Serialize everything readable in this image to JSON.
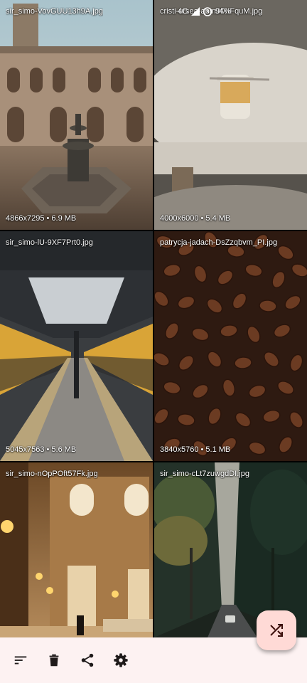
{
  "status_bar": {
    "network": "4G",
    "battery": "94%"
  },
  "photos": [
    {
      "filename": "sir_simo-VovGUU13h9A.jpg",
      "meta": "4866x7295 • 6.9 MB"
    },
    {
      "filename": "cristi-ursea-abm9fXIFquM.jpg",
      "meta": "4000x6000 • 5.4 MB"
    },
    {
      "filename": "sir_simo-lU-9XF7Prt0.jpg",
      "meta": "5045x7563 • 5.6 MB"
    },
    {
      "filename": "patrycja-jadach-DsZzqbvm_PI.jpg",
      "meta": "3840x5760 • 5.1 MB"
    },
    {
      "filename": "sir_simo-nOpPOft57Fk.jpg",
      "meta": ""
    },
    {
      "filename": "sir_simo-cLt7zuwgdDI.jpg",
      "meta": ""
    }
  ],
  "toolbar": {
    "icons": [
      "sort-icon",
      "delete-icon",
      "share-icon",
      "settings-icon"
    ]
  },
  "fab": {
    "icon": "shuffle-icon"
  },
  "colors": {
    "bar_bg": "#fdf2f2",
    "fab_bg": "#ffdad6",
    "icon": "#1f1a1a"
  }
}
